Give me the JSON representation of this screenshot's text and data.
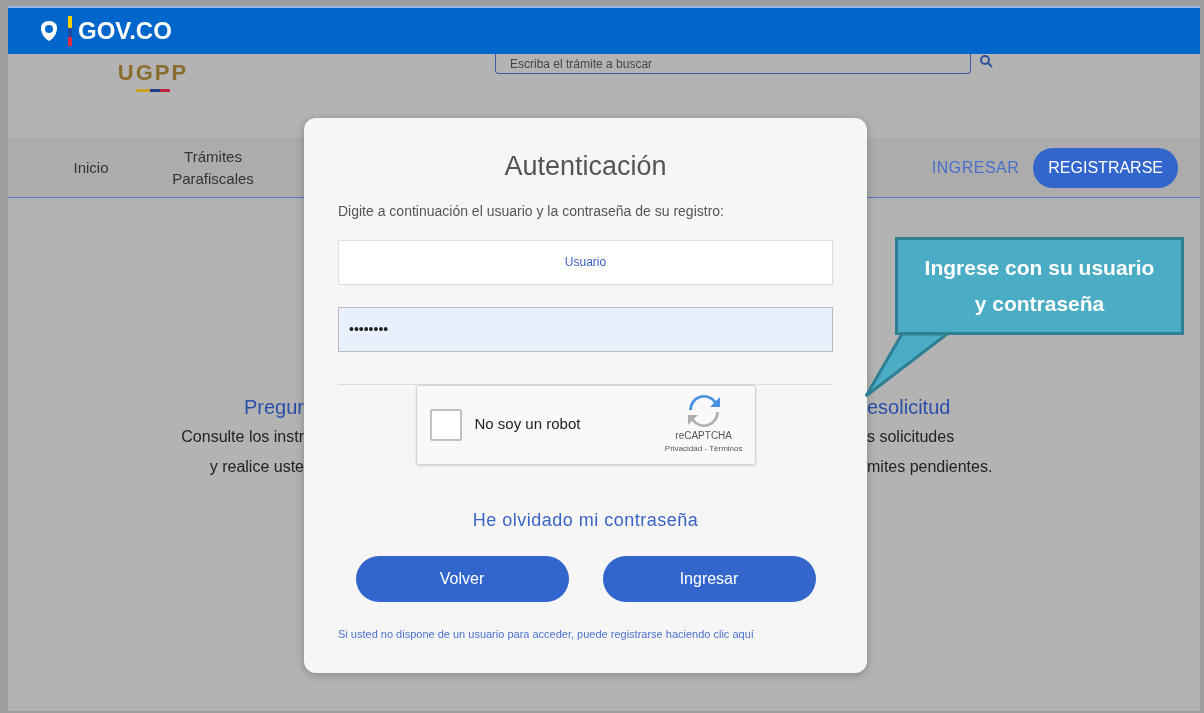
{
  "top_bar": {
    "brand": "GOV.CO"
  },
  "header": {
    "logo_text": "UGPP",
    "search": {
      "placeholder": "Escriba el trámite a buscar"
    }
  },
  "nav": {
    "items": [
      {
        "label": "Inicio"
      },
      {
        "label": "Trámites Parafiscales"
      }
    ],
    "login": "INGRESAR",
    "register": "REGISTRARSE"
  },
  "content": {
    "left_title": "Pregur",
    "left_lines": [
      "Consulte los instr",
      "y realice uste"
    ],
    "right_title": "esolicitud",
    "right_lines": [
      "s solicitudes",
      "mites pendientes."
    ]
  },
  "dialog": {
    "title": "Autenticación",
    "instruction": "Digite a continuación el usuario y la contraseña de su registro:",
    "username": {
      "placeholder": "Usuario"
    },
    "password": {
      "value": "••••••••"
    },
    "captcha": {
      "checked": false,
      "label": "No soy un robot",
      "brand": "reCAPTCHA",
      "links": "Privacidad - Términos"
    },
    "forgot_link": "He olvidado mi contraseña",
    "buttons": [
      "Volver",
      "Ingresar"
    ],
    "register_hint": "Si usted no dispone de un usuario para acceder, puede registrarse haciendo clic aquí"
  },
  "callout": {
    "text": "Ingrese con su usuario y contraseña"
  }
}
